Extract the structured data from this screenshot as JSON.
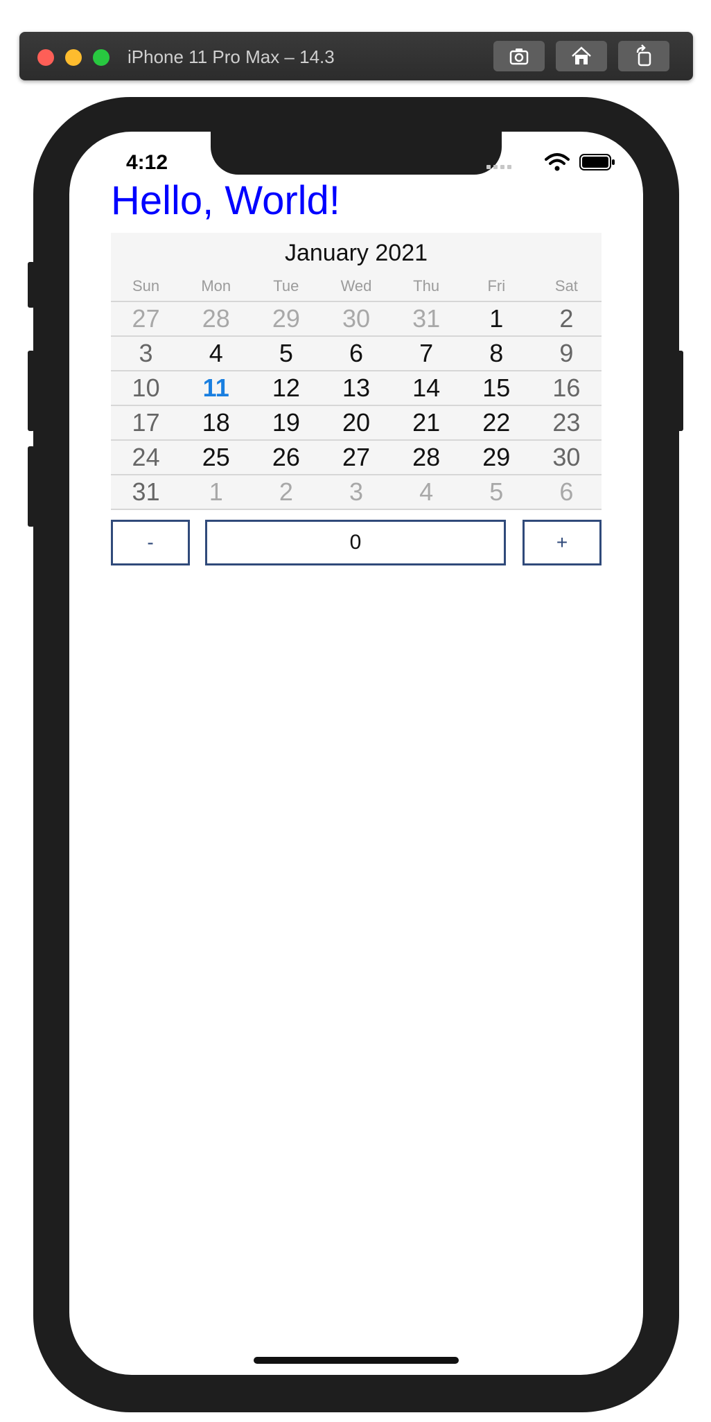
{
  "simulator": {
    "title": "iPhone 11 Pro Max – 14.3",
    "buttons": [
      "screenshot-icon",
      "home-icon",
      "rotate-icon"
    ]
  },
  "status_bar": {
    "time": "4:12"
  },
  "app": {
    "heading": "Hello, World!"
  },
  "calendar": {
    "title": "January 2021",
    "weekdays": [
      "Sun",
      "Mon",
      "Tue",
      "Wed",
      "Thu",
      "Fri",
      "Sat"
    ],
    "weeks": [
      [
        {
          "d": "27",
          "s": "out"
        },
        {
          "d": "28",
          "s": "out"
        },
        {
          "d": "29",
          "s": "out"
        },
        {
          "d": "30",
          "s": "out"
        },
        {
          "d": "31",
          "s": "out"
        },
        {
          "d": "1",
          "s": "in"
        },
        {
          "d": "2",
          "s": "weekend"
        }
      ],
      [
        {
          "d": "3",
          "s": "weekend"
        },
        {
          "d": "4",
          "s": "in"
        },
        {
          "d": "5",
          "s": "in"
        },
        {
          "d": "6",
          "s": "in"
        },
        {
          "d": "7",
          "s": "in"
        },
        {
          "d": "8",
          "s": "in"
        },
        {
          "d": "9",
          "s": "weekend"
        }
      ],
      [
        {
          "d": "10",
          "s": "weekend"
        },
        {
          "d": "11",
          "s": "today"
        },
        {
          "d": "12",
          "s": "in"
        },
        {
          "d": "13",
          "s": "in"
        },
        {
          "d": "14",
          "s": "in"
        },
        {
          "d": "15",
          "s": "in"
        },
        {
          "d": "16",
          "s": "weekend"
        }
      ],
      [
        {
          "d": "17",
          "s": "weekend"
        },
        {
          "d": "18",
          "s": "in"
        },
        {
          "d": "19",
          "s": "in"
        },
        {
          "d": "20",
          "s": "in"
        },
        {
          "d": "21",
          "s": "in"
        },
        {
          "d": "22",
          "s": "in"
        },
        {
          "d": "23",
          "s": "weekend"
        }
      ],
      [
        {
          "d": "24",
          "s": "weekend"
        },
        {
          "d": "25",
          "s": "in"
        },
        {
          "d": "26",
          "s": "in"
        },
        {
          "d": "27",
          "s": "in"
        },
        {
          "d": "28",
          "s": "in"
        },
        {
          "d": "29",
          "s": "in"
        },
        {
          "d": "30",
          "s": "weekend"
        }
      ],
      [
        {
          "d": "31",
          "s": "weekend"
        },
        {
          "d": "1",
          "s": "out"
        },
        {
          "d": "2",
          "s": "out"
        },
        {
          "d": "3",
          "s": "out"
        },
        {
          "d": "4",
          "s": "out"
        },
        {
          "d": "5",
          "s": "out"
        },
        {
          "d": "6",
          "s": "out"
        }
      ]
    ]
  },
  "stepper": {
    "minus_label": "-",
    "value": "0",
    "plus_label": "+"
  },
  "colors": {
    "heading": "#0000ff",
    "today": "#1a7fe0",
    "stepper_border": "#304a7a"
  }
}
